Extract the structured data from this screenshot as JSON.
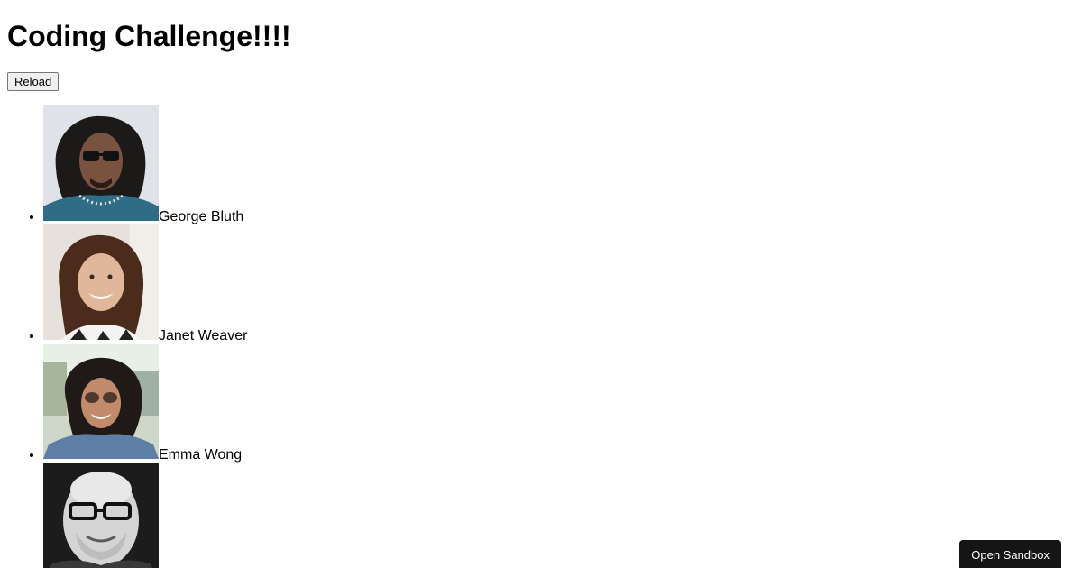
{
  "header": {
    "title": "Coding Challenge!!!!"
  },
  "toolbar": {
    "reload_label": "Reload"
  },
  "users": [
    {
      "name": "George Bluth",
      "avatar_icon": "avatar-photo-george"
    },
    {
      "name": "Janet Weaver",
      "avatar_icon": "avatar-photo-janet"
    },
    {
      "name": "Emma Wong",
      "avatar_icon": "avatar-photo-emma"
    },
    {
      "name": "",
      "avatar_icon": "avatar-photo-4"
    }
  ],
  "footer": {
    "open_sandbox_label": "Open Sandbox"
  },
  "colors": {
    "sandbox_button_bg": "#151515",
    "sandbox_button_text": "#ffffff"
  }
}
